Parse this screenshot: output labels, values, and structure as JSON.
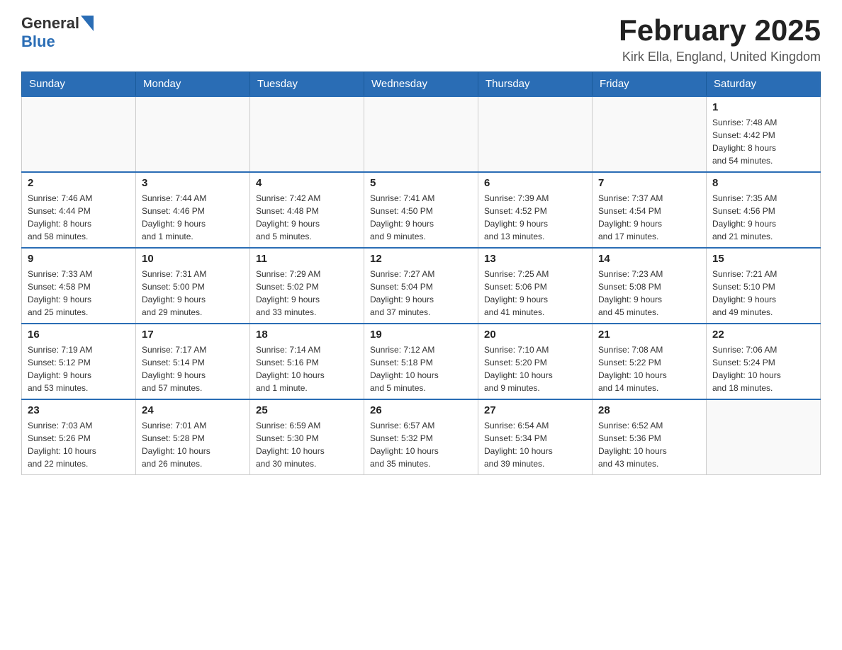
{
  "header": {
    "logo_general": "General",
    "logo_blue": "Blue",
    "title": "February 2025",
    "subtitle": "Kirk Ella, England, United Kingdom"
  },
  "weekdays": [
    "Sunday",
    "Monday",
    "Tuesday",
    "Wednesday",
    "Thursday",
    "Friday",
    "Saturday"
  ],
  "weeks": [
    [
      {
        "day": "",
        "info": ""
      },
      {
        "day": "",
        "info": ""
      },
      {
        "day": "",
        "info": ""
      },
      {
        "day": "",
        "info": ""
      },
      {
        "day": "",
        "info": ""
      },
      {
        "day": "",
        "info": ""
      },
      {
        "day": "1",
        "info": "Sunrise: 7:48 AM\nSunset: 4:42 PM\nDaylight: 8 hours\nand 54 minutes."
      }
    ],
    [
      {
        "day": "2",
        "info": "Sunrise: 7:46 AM\nSunset: 4:44 PM\nDaylight: 8 hours\nand 58 minutes."
      },
      {
        "day": "3",
        "info": "Sunrise: 7:44 AM\nSunset: 4:46 PM\nDaylight: 9 hours\nand 1 minute."
      },
      {
        "day": "4",
        "info": "Sunrise: 7:42 AM\nSunset: 4:48 PM\nDaylight: 9 hours\nand 5 minutes."
      },
      {
        "day": "5",
        "info": "Sunrise: 7:41 AM\nSunset: 4:50 PM\nDaylight: 9 hours\nand 9 minutes."
      },
      {
        "day": "6",
        "info": "Sunrise: 7:39 AM\nSunset: 4:52 PM\nDaylight: 9 hours\nand 13 minutes."
      },
      {
        "day": "7",
        "info": "Sunrise: 7:37 AM\nSunset: 4:54 PM\nDaylight: 9 hours\nand 17 minutes."
      },
      {
        "day": "8",
        "info": "Sunrise: 7:35 AM\nSunset: 4:56 PM\nDaylight: 9 hours\nand 21 minutes."
      }
    ],
    [
      {
        "day": "9",
        "info": "Sunrise: 7:33 AM\nSunset: 4:58 PM\nDaylight: 9 hours\nand 25 minutes."
      },
      {
        "day": "10",
        "info": "Sunrise: 7:31 AM\nSunset: 5:00 PM\nDaylight: 9 hours\nand 29 minutes."
      },
      {
        "day": "11",
        "info": "Sunrise: 7:29 AM\nSunset: 5:02 PM\nDaylight: 9 hours\nand 33 minutes."
      },
      {
        "day": "12",
        "info": "Sunrise: 7:27 AM\nSunset: 5:04 PM\nDaylight: 9 hours\nand 37 minutes."
      },
      {
        "day": "13",
        "info": "Sunrise: 7:25 AM\nSunset: 5:06 PM\nDaylight: 9 hours\nand 41 minutes."
      },
      {
        "day": "14",
        "info": "Sunrise: 7:23 AM\nSunset: 5:08 PM\nDaylight: 9 hours\nand 45 minutes."
      },
      {
        "day": "15",
        "info": "Sunrise: 7:21 AM\nSunset: 5:10 PM\nDaylight: 9 hours\nand 49 minutes."
      }
    ],
    [
      {
        "day": "16",
        "info": "Sunrise: 7:19 AM\nSunset: 5:12 PM\nDaylight: 9 hours\nand 53 minutes."
      },
      {
        "day": "17",
        "info": "Sunrise: 7:17 AM\nSunset: 5:14 PM\nDaylight: 9 hours\nand 57 minutes."
      },
      {
        "day": "18",
        "info": "Sunrise: 7:14 AM\nSunset: 5:16 PM\nDaylight: 10 hours\nand 1 minute."
      },
      {
        "day": "19",
        "info": "Sunrise: 7:12 AM\nSunset: 5:18 PM\nDaylight: 10 hours\nand 5 minutes."
      },
      {
        "day": "20",
        "info": "Sunrise: 7:10 AM\nSunset: 5:20 PM\nDaylight: 10 hours\nand 9 minutes."
      },
      {
        "day": "21",
        "info": "Sunrise: 7:08 AM\nSunset: 5:22 PM\nDaylight: 10 hours\nand 14 minutes."
      },
      {
        "day": "22",
        "info": "Sunrise: 7:06 AM\nSunset: 5:24 PM\nDaylight: 10 hours\nand 18 minutes."
      }
    ],
    [
      {
        "day": "23",
        "info": "Sunrise: 7:03 AM\nSunset: 5:26 PM\nDaylight: 10 hours\nand 22 minutes."
      },
      {
        "day": "24",
        "info": "Sunrise: 7:01 AM\nSunset: 5:28 PM\nDaylight: 10 hours\nand 26 minutes."
      },
      {
        "day": "25",
        "info": "Sunrise: 6:59 AM\nSunset: 5:30 PM\nDaylight: 10 hours\nand 30 minutes."
      },
      {
        "day": "26",
        "info": "Sunrise: 6:57 AM\nSunset: 5:32 PM\nDaylight: 10 hours\nand 35 minutes."
      },
      {
        "day": "27",
        "info": "Sunrise: 6:54 AM\nSunset: 5:34 PM\nDaylight: 10 hours\nand 39 minutes."
      },
      {
        "day": "28",
        "info": "Sunrise: 6:52 AM\nSunset: 5:36 PM\nDaylight: 10 hours\nand 43 minutes."
      },
      {
        "day": "",
        "info": ""
      }
    ]
  ]
}
